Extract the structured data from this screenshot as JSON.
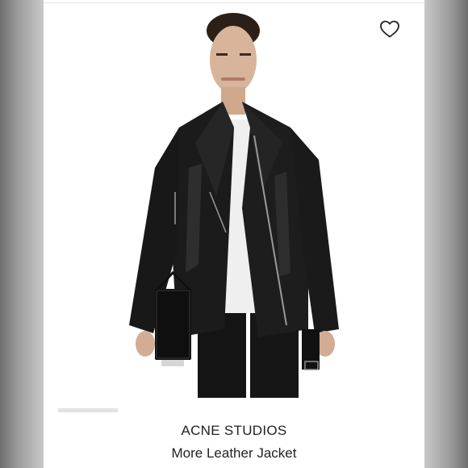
{
  "product": {
    "brand": "ACNE STUDIOS",
    "name": "More Leather Jacket"
  },
  "icons": {
    "favorite": "heart-icon"
  },
  "image": {
    "alt": "Model wearing black leather jacket with white t-shirt and black pants, holding a black handbag"
  },
  "colors": {
    "background": "#ffffff",
    "text": "#222222",
    "indicator": "#e2e2e2"
  }
}
